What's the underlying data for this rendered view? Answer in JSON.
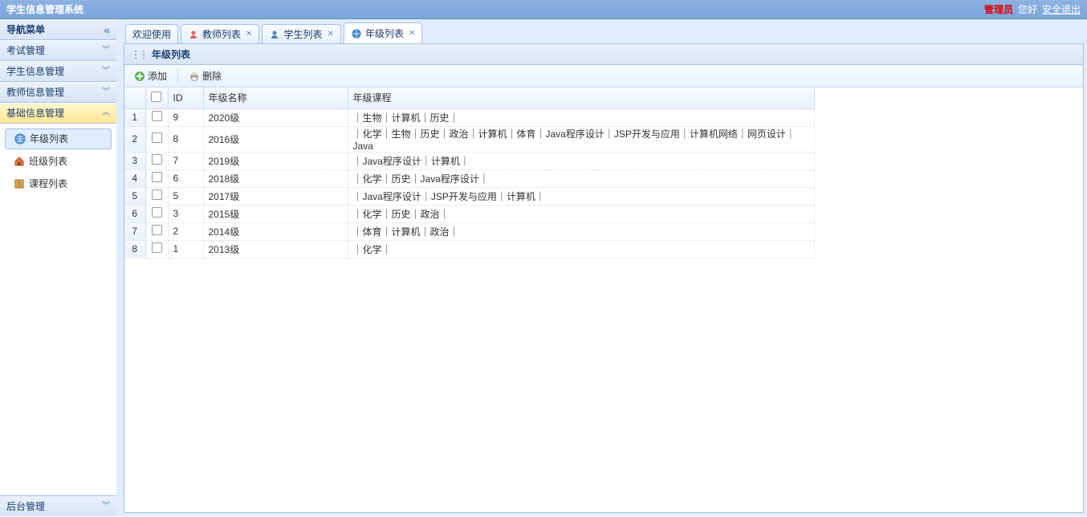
{
  "header": {
    "title": "学生信息管理系统",
    "admin": "管理员",
    "greet": "您好",
    "logout": "安全退出"
  },
  "sidebar": {
    "title": "导航菜单",
    "sections": [
      {
        "label": "考试管理"
      },
      {
        "label": "学生信息管理"
      },
      {
        "label": "教师信息管理"
      },
      {
        "label": "基础信息管理"
      }
    ],
    "tree": [
      {
        "label": "年级列表",
        "icon": "globe"
      },
      {
        "label": "班级列表",
        "icon": "home"
      },
      {
        "label": "课程列表",
        "icon": "book"
      }
    ],
    "bottom": "后台管理"
  },
  "tabs": [
    {
      "label": "欢迎使用",
      "closable": false,
      "icon": null
    },
    {
      "label": "教师列表",
      "closable": true,
      "icon": "person-red"
    },
    {
      "label": "学生列表",
      "closable": true,
      "icon": "person-blue"
    },
    {
      "label": "年级列表",
      "closable": true,
      "icon": "globe"
    }
  ],
  "panel": {
    "title": "年级列表"
  },
  "toolbar": {
    "add": "添加",
    "delete": "删除"
  },
  "grid": {
    "columns": {
      "id": "ID",
      "name": "年级名称",
      "courses": "年级课程"
    },
    "rows": [
      {
        "num": "1",
        "id": "9",
        "name": "2020级",
        "courses": "｜生物｜计算机｜历史｜"
      },
      {
        "num": "2",
        "id": "8",
        "name": "2016级",
        "courses": "｜化学｜生物｜历史｜政治｜计算机｜体育｜Java程序设计｜JSP开发与应用｜计算机网络｜网页设计｜Java"
      },
      {
        "num": "3",
        "id": "7",
        "name": "2019级",
        "courses": "｜Java程序设计｜计算机｜"
      },
      {
        "num": "4",
        "id": "6",
        "name": "2018级",
        "courses": "｜化学｜历史｜Java程序设计｜"
      },
      {
        "num": "5",
        "id": "5",
        "name": "2017级",
        "courses": "｜Java程序设计｜JSP开发与应用｜计算机｜"
      },
      {
        "num": "6",
        "id": "3",
        "name": "2015级",
        "courses": "｜化学｜历史｜政治｜"
      },
      {
        "num": "7",
        "id": "2",
        "name": "2014级",
        "courses": "｜体育｜计算机｜政治｜"
      },
      {
        "num": "8",
        "id": "1",
        "name": "2013级",
        "courses": "｜化学｜"
      }
    ]
  }
}
